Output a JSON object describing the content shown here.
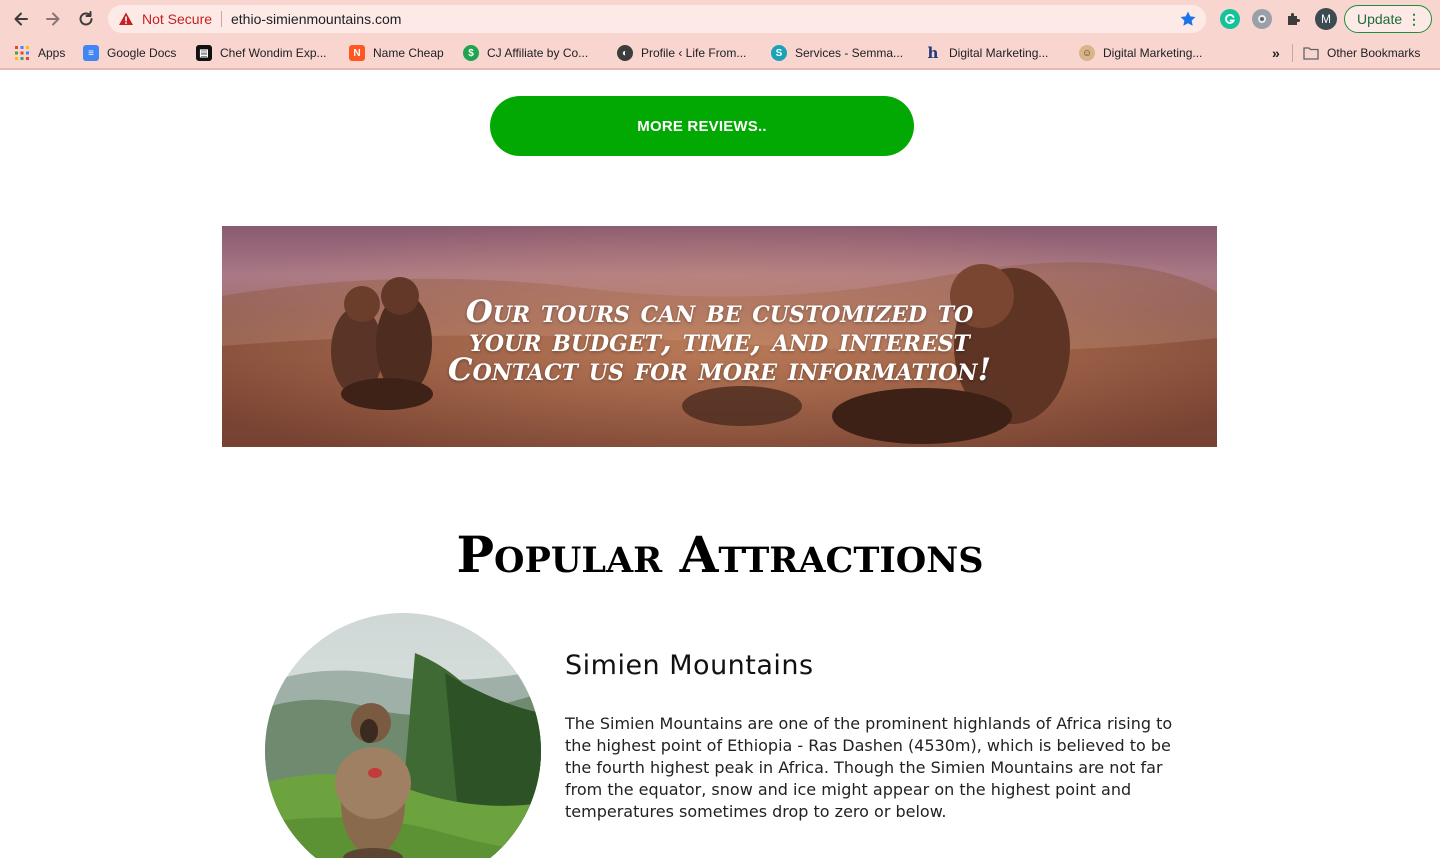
{
  "browser": {
    "security_label": "Not Secure",
    "url": "ethio-simienmountains.com",
    "update_label": "Update",
    "profile_initial": "M",
    "bookmarks": [
      {
        "label": "Apps"
      },
      {
        "label": "Google Docs"
      },
      {
        "label": "Chef Wondim Exp..."
      },
      {
        "label": "Name Cheap"
      },
      {
        "label": "CJ Affiliate by Co..."
      },
      {
        "label": "Profile ‹ Life From..."
      },
      {
        "label": "Services - Semma..."
      },
      {
        "label": "Digital Marketing..."
      },
      {
        "label": "Digital Marketing..."
      }
    ],
    "overflow_label": "»",
    "other_bookmarks": "Other Bookmarks"
  },
  "reviews": {
    "button_label": "MORE REVIEWS.."
  },
  "banner": {
    "line1": "Our tours can be customized to",
    "line2": "your budget, time, and interest",
    "line3": "Contact us for more information!"
  },
  "attractions": {
    "title": "Popular Attractions",
    "items": [
      {
        "name": "Simien Mountains",
        "description": "The Simien Mountains are one of the prominent highlands of Africa rising to the highest point of Ethiopia - Ras Dashen (4530m), which is believed to be the fourth highest peak in Africa. Though the Simien Mountains are not far from the equator, snow and ice might appear on the highest point and temperatures sometimes drop to zero or below."
      }
    ]
  }
}
